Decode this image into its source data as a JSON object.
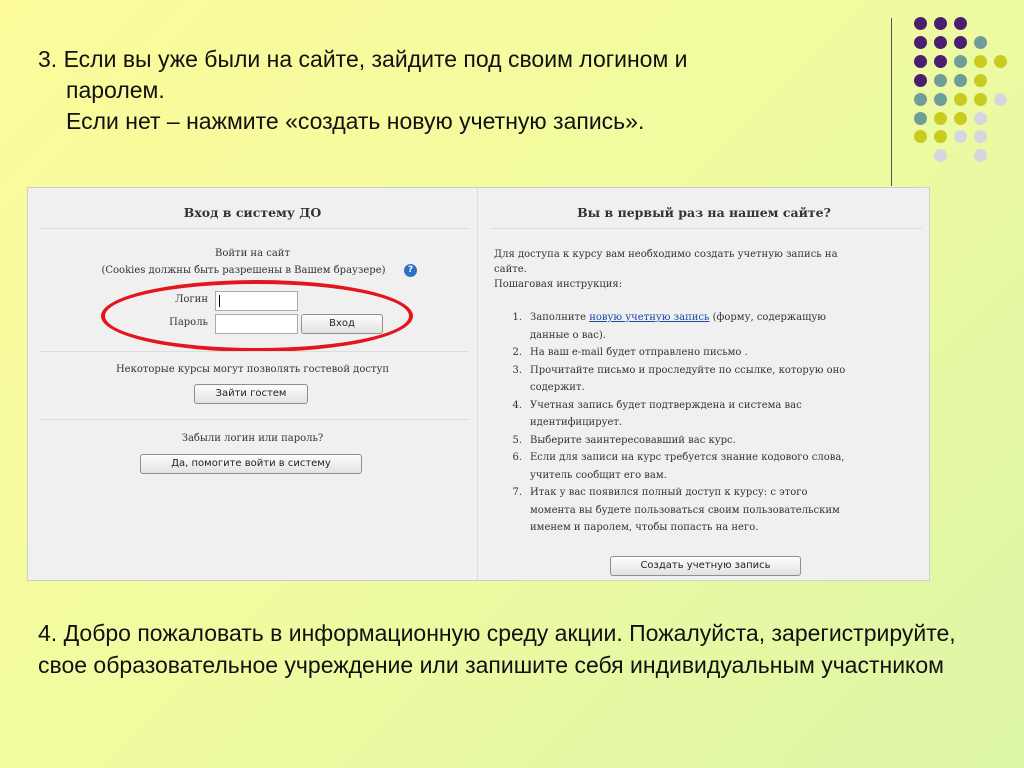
{
  "step3": {
    "line1": "3. Если вы уже были на сайте, зайдите под своим логином и",
    "line2": "паролем.",
    "line3": "Если нет – нажмите «создать новую учетную запись»."
  },
  "step4": {
    "text": "4. Добро пожаловать в информационную среду акции. Пожалуйста, зарегистрируйте, свое образовательное учреждение или запишите себя индивидуальным участником"
  },
  "decor": {
    "dot_colors": {
      "purple": "#4b1f6f",
      "teal": "#6f9e9a",
      "olive": "#c8cc1e",
      "gray": "#d6d6de"
    }
  },
  "login_panel": {
    "title": "Вход в систему ДО",
    "login_to_site": "Войти на сайт",
    "cookies_note": "(Cookies должны быть разрешены в Вашем браузере)",
    "help_icon": "?",
    "login_label": "Логин",
    "password_label": "Пароль",
    "login_value": "",
    "password_value": "",
    "submit": "Вход",
    "guest_note": "Некоторые курсы могут позволять гостевой доступ",
    "guest_button": "Зайти гостем",
    "forgot_note": "Забыли логин или пароль?",
    "forgot_button": "Да, помогите войти в систему",
    "highlight_color": "#e3161e"
  },
  "signup_panel": {
    "title": "Вы в первый раз на нашем сайте?",
    "intro_line1": "Для доступа к курсу вам необходимо создать учетную запись на",
    "intro_line2": "сайте.",
    "instructions_heading": "Пошаговая инструкция:",
    "steps": [
      {
        "num": "1.",
        "pre": "Заполните ",
        "link": "новую учетную запись",
        "post": " (форму, содержащую",
        "line2": "данные о вас)."
      },
      {
        "num": "2.",
        "text": "На ваш e-mail будет отправлено письмо ."
      },
      {
        "num": "3.",
        "text": "Прочитайте письмо и проследуйте по ссылке, которую оно",
        "line2": "содержит."
      },
      {
        "num": "4.",
        "text": "Учетная запись будет подтверждена и система вас",
        "line2": "идентифицирует."
      },
      {
        "num": "5.",
        "text": "Выберите заинтересовавший вас курс."
      },
      {
        "num": "6.",
        "text": "Если для записи на курс требуется знание кодового слова,",
        "line2": "учитель сообщит его вам."
      },
      {
        "num": "7.",
        "text": "Итак у вас появился полный доступ к курсу: с этого",
        "line2": "момента вы будете пользоваться своим пользовательским",
        "line3": "именем и паролем, чтобы попасть на него."
      }
    ],
    "create_button": "Создать учетную запись"
  }
}
